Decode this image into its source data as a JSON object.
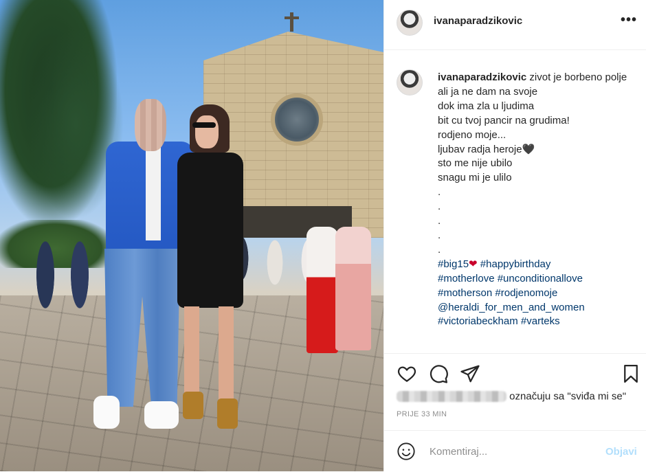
{
  "post": {
    "username": "ivanaparadzikovic",
    "more_icon": "•••",
    "caption": {
      "username": "ivanaparadzikovic",
      "first_line": " zivot je borbeno polje",
      "lines": [
        "ali ja ne dam na svoje",
        "dok ima zla u ljudima",
        "bit cu tvoj pancir na grudima!",
        "rodjeno moje...",
        "ljubav radja heroje",
        "sto me nije ubilo",
        "snagu mi je ulilo",
        ".",
        ".",
        ".",
        ".",
        "."
      ],
      "black_heart": "🖤",
      "hashtags_line1": [
        "#big15",
        "#happybirthday"
      ],
      "red_heart": "❤",
      "hashtags_line2": [
        "#motherlove",
        "#unconditionallove"
      ],
      "hashtags_line3": [
        "#motherson",
        "#rodjenomoje"
      ],
      "mention": "@heraldi_for_men_and_women",
      "hashtags_line5": [
        "#victoriabeckham",
        "#varteks"
      ]
    },
    "likes_text": "označuju sa \"sviđa mi se\"",
    "timestamp": "PRIJE 33 MIN",
    "comment_placeholder": "Komentiraj...",
    "post_button": "Objavi"
  },
  "icons": {
    "more": "more-options-icon",
    "like": "heart-icon",
    "comment": "comment-icon",
    "share": "share-icon",
    "save": "bookmark-icon",
    "emoji": "emoji-icon"
  },
  "colors": {
    "hashtag": "#00376b",
    "post_button": "#b2dffc",
    "muted": "#8e8e8e",
    "border": "#efefef"
  }
}
